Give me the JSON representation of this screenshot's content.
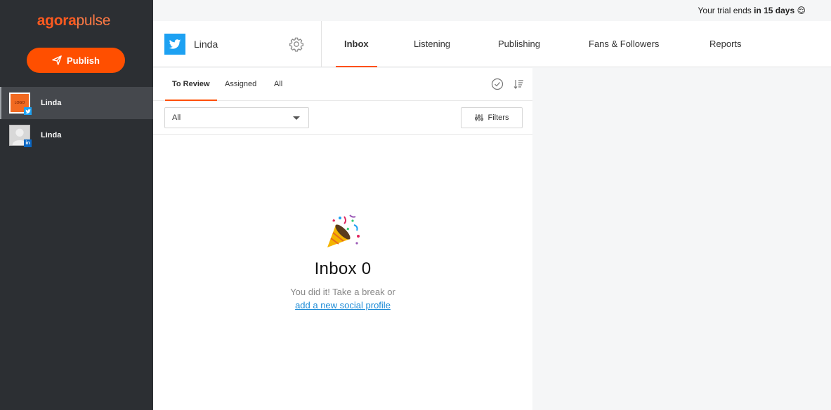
{
  "brand": {
    "name_part1": "agora",
    "name_part2": "pulse",
    "accent": "#ff4f00"
  },
  "sidebar": {
    "publish_label": "Publish",
    "profiles": [
      {
        "name": "Linda",
        "network": "twitter",
        "avatar_text": "LOGO",
        "active": true
      },
      {
        "name": "Linda",
        "network": "linkedin",
        "avatar_text": "",
        "active": false
      }
    ]
  },
  "trial": {
    "prefix": "Your trial ends ",
    "emphasis": "in 15 days",
    "emoji": "😌"
  },
  "header": {
    "account_name": "Linda",
    "tabs": [
      {
        "label": "Inbox",
        "active": true
      },
      {
        "label": "Listening",
        "active": false
      },
      {
        "label": "Publishing",
        "active": false
      },
      {
        "label": "Fans & Followers",
        "active": false
      },
      {
        "label": "Reports",
        "active": false
      }
    ]
  },
  "inbox": {
    "subtabs": [
      {
        "label": "To Review",
        "active": true
      },
      {
        "label": "Assigned",
        "active": false
      },
      {
        "label": "All",
        "active": false
      }
    ],
    "select_value": "All",
    "filters_label": "Filters",
    "empty": {
      "title": "Inbox 0",
      "subtitle": "You did it! Take a break or",
      "link": "add a new social profile"
    }
  }
}
